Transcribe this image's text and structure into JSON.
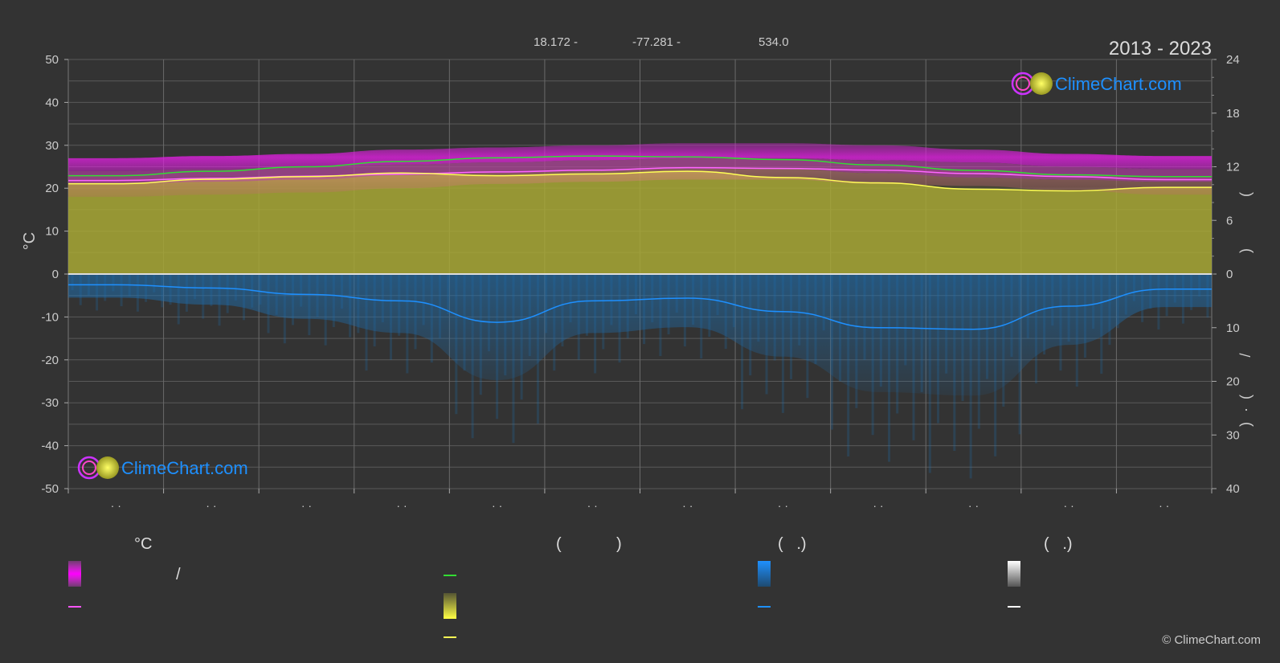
{
  "header": {
    "years": "2013 - 2023",
    "latitude": "18.172 -",
    "longitude": "-77.281 -",
    "elevation": "534.0"
  },
  "axes": {
    "left_unit": "°C",
    "right_side_marks": [
      "(",
      ")",
      "/",
      "(",
      "·",
      ")"
    ]
  },
  "legend": {
    "col1_header": "°C",
    "col2_header_open": "(",
    "col2_header_close": ")",
    "col3_header": "(   .)",
    "col4_header": "(   .)",
    "slash": "/"
  },
  "watermark": "ClimeChart.com",
  "copyright": "© ClimeChart.com",
  "colors": {
    "background": "#333333",
    "max_temp_band": "#e020e0",
    "min_temp_band": "#ff8aa0",
    "daylight_line": "#33dd33",
    "sunshine_fill": "#b5b535",
    "sunshine_line": "#ffff55",
    "avg_temp_line": "#ff55ff",
    "precip_fill": "#1e6fb0",
    "precip_line": "#1e90ff",
    "snow": "#ffffff"
  },
  "chart_data": {
    "type": "area",
    "title": "",
    "x_tick_labels": [
      "· ·",
      "· ·",
      "· ·",
      "· ·",
      "· ·",
      "· ·",
      "· ·",
      "· ·",
      "· ·",
      "· ·",
      "· ·",
      "· ·"
    ],
    "months": [
      1,
      2,
      3,
      4,
      5,
      6,
      7,
      8,
      9,
      10,
      11,
      12
    ],
    "left_axis": {
      "label": "°C",
      "ylim": [
        -50,
        50
      ],
      "ticks": [
        50,
        40,
        30,
        20,
        10,
        0,
        -10,
        -20,
        -30,
        -40,
        -50
      ]
    },
    "right_axis_top": {
      "ylim": [
        0,
        24
      ],
      "ticks": [
        24,
        18,
        12,
        6,
        0
      ]
    },
    "right_axis_bottom": {
      "ylim": [
        0,
        40
      ],
      "ticks": [
        0,
        10,
        20,
        30,
        40
      ]
    },
    "series": [
      {
        "key": "max_temp_range",
        "values": [
          27,
          27.5,
          28,
          29,
          29.5,
          30,
          30.5,
          30.5,
          30,
          29,
          28,
          27.5
        ]
      },
      {
        "key": "avg_max",
        "values": [
          24,
          24.5,
          25,
          25.5,
          26,
          26.5,
          27,
          27,
          26.5,
          26,
          25,
          24.5
        ]
      },
      {
        "key": "avg_min",
        "values": [
          21,
          21.5,
          22,
          23,
          23.5,
          24,
          24.5,
          24.5,
          23.5,
          22.5,
          22,
          21.5
        ]
      },
      {
        "key": "min_temp_range",
        "values": [
          18,
          18.5,
          19,
          20,
          21,
          21.5,
          22,
          22,
          21,
          20.5,
          19.5,
          18.5
        ]
      },
      {
        "key": "avg_temp_line",
        "values": [
          21.8,
          22.3,
          22.8,
          23.3,
          23.8,
          24.2,
          24.8,
          24.6,
          24.2,
          23.4,
          22.7,
          22.0
        ]
      },
      {
        "key": "daylight_hours",
        "values": [
          11.0,
          11.5,
          12.0,
          12.6,
          13.0,
          13.2,
          13.1,
          12.8,
          12.2,
          11.6,
          11.1,
          10.9
        ]
      },
      {
        "key": "sunshine_hours",
        "values": [
          10.1,
          10.6,
          10.9,
          11.3,
          11.0,
          11.2,
          11.5,
          10.8,
          10.2,
          9.5,
          9.3,
          9.7
        ]
      },
      {
        "key": "precip_mm_per_day",
        "values": [
          2.0,
          2.6,
          3.8,
          5.0,
          9.0,
          5.0,
          4.5,
          7.0,
          10.0,
          10.3,
          6.0,
          2.8
        ]
      }
    ],
    "grid": true
  }
}
